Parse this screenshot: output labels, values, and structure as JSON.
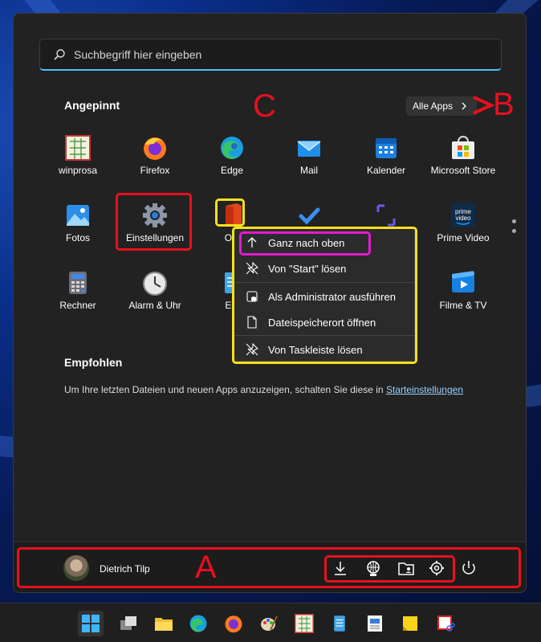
{
  "search": {
    "placeholder": "Suchbegriff hier eingeben"
  },
  "pinned": {
    "heading": "Angepinnt",
    "all_apps": "Alle Apps",
    "apps": [
      {
        "label": "winprosa",
        "icon": "winprosa-icon"
      },
      {
        "label": "Firefox",
        "icon": "firefox-icon"
      },
      {
        "label": "Edge",
        "icon": "edge-icon"
      },
      {
        "label": "Mail",
        "icon": "mail-icon"
      },
      {
        "label": "Kalender",
        "icon": "calendar-icon"
      },
      {
        "label": "Microsoft Store",
        "icon": "store-icon"
      },
      {
        "label": "Fotos",
        "icon": "photos-icon"
      },
      {
        "label": "Einstellungen",
        "icon": "settings-icon"
      },
      {
        "label": "Offi",
        "icon": "office-icon"
      },
      {
        "label": "",
        "icon": "todo-icon"
      },
      {
        "label": "",
        "icon": "snip-icon"
      },
      {
        "label": "Prime Video",
        "icon": "prime-video-icon"
      },
      {
        "label": "Rechner",
        "icon": "calculator-icon"
      },
      {
        "label": "Alarm & Uhr",
        "icon": "clock-icon"
      },
      {
        "label": "Edi",
        "icon": "notepad-icon"
      },
      {
        "label": "",
        "icon": "blank"
      },
      {
        "label": "",
        "icon": "blank"
      },
      {
        "label": "Filme & TV",
        "icon": "movies-icon"
      }
    ]
  },
  "recommended": {
    "heading": "Empfohlen",
    "text": "Um Ihre letzten Dateien und neuen Apps anzuzeigen, schalten Sie diese in ",
    "link": "Starteinstellungen"
  },
  "context_menu": {
    "items": [
      {
        "label": "Ganz nach oben",
        "icon": "arrow-up-icon"
      },
      {
        "label": "Von \"Start\" lösen",
        "icon": "unpin-icon"
      },
      {
        "label": "Als Administrator ausführen",
        "icon": "admin-shield-icon"
      },
      {
        "label": "Dateispeicherort öffnen",
        "icon": "file-location-icon"
      },
      {
        "label": "Von Taskleiste lösen",
        "icon": "unpin-taskbar-icon"
      }
    ]
  },
  "footer": {
    "user_name": "Dietrich Tilp",
    "icons": [
      "downloads-icon",
      "network-icon",
      "personal-folder-icon",
      "settings-icon",
      "power-icon"
    ]
  },
  "annotations": {
    "a": "A",
    "b": "B",
    "c": "C",
    "color_red": "#e8101e",
    "color_yellow": "#f5e11b",
    "color_magenta": "#e21bd0"
  },
  "taskbar": {
    "icons": [
      "start-icon",
      "task-view-icon",
      "file-explorer-icon",
      "edge-icon",
      "firefox-icon",
      "paint-icon",
      "winprosa-icon",
      "notepad-icon",
      "wordpad-icon",
      "sticky-notes-icon",
      "snipping-tool-icon"
    ]
  },
  "colors": {
    "accent": "#4cc2ff",
    "panel": "#222222"
  }
}
